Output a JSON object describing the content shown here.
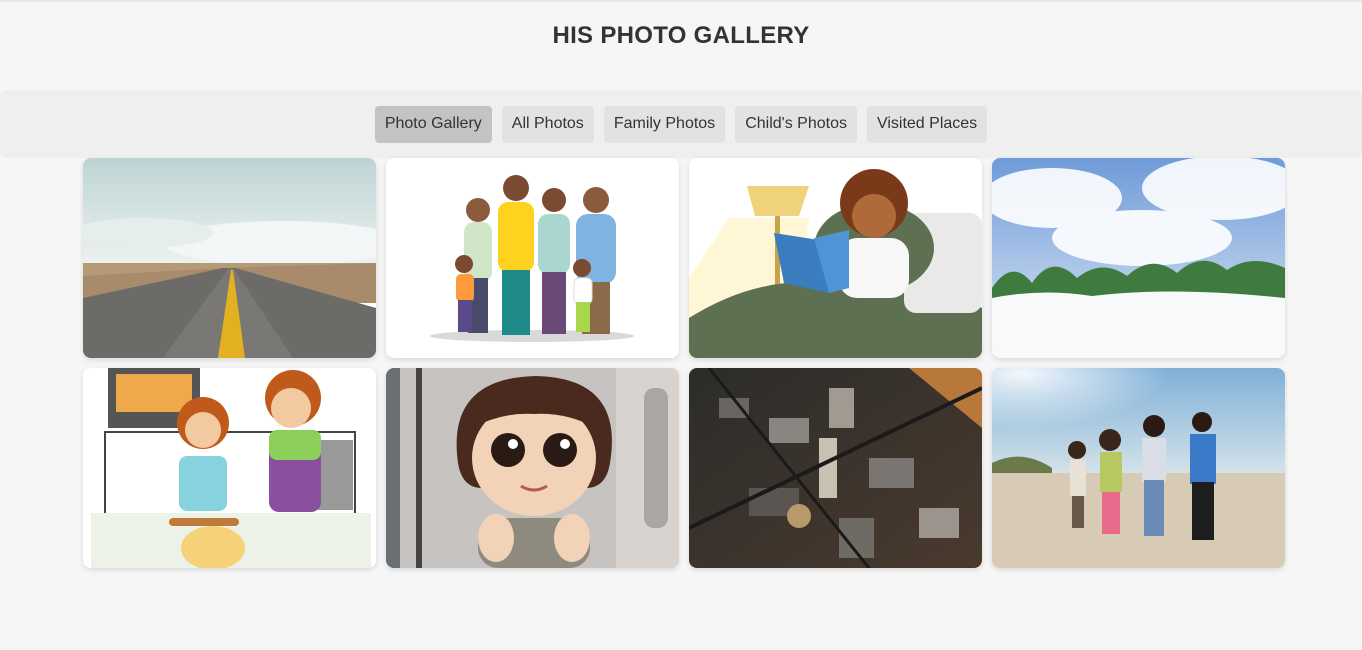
{
  "header": {
    "title": "HIS PHOTO GALLERY"
  },
  "nav": {
    "items": [
      {
        "label": "Photo Gallery",
        "active": true
      },
      {
        "label": "All Photos",
        "active": false
      },
      {
        "label": "Family Photos",
        "active": false
      },
      {
        "label": "Child's Photos",
        "active": false
      },
      {
        "label": "Visited Places",
        "active": false
      }
    ]
  },
  "gallery": {
    "photos": [
      {
        "subject": "desert-road"
      },
      {
        "subject": "family-illustration"
      },
      {
        "subject": "reading-in-bed"
      },
      {
        "subject": "snowy-forest"
      },
      {
        "subject": "baking-illustration"
      },
      {
        "subject": "cartoon-girl"
      },
      {
        "subject": "city-aerial"
      },
      {
        "subject": "family-walking"
      }
    ]
  }
}
